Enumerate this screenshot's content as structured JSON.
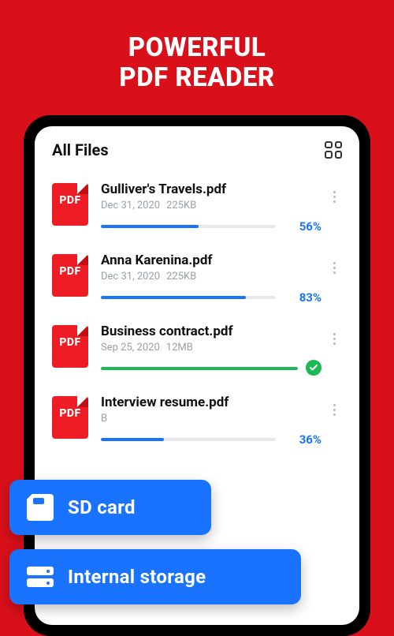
{
  "hero": {
    "line1": "POWERFUL",
    "line2": "PDF READER"
  },
  "screen": {
    "title": "All Files",
    "pdf_badge": "PDF"
  },
  "files": [
    {
      "name": "Gulliver's Travels.pdf",
      "date": "Dec 31, 2020",
      "size": "225KB",
      "progress": 56,
      "percent_label": "56%",
      "bar_color": "#1a73ff",
      "percent_color": "#1a73ff",
      "has_percent": true,
      "has_check": false
    },
    {
      "name": "Anna Karenina.pdf",
      "date": "Dec 31, 2020",
      "size": "225KB",
      "progress": 83,
      "percent_label": "83%",
      "bar_color": "#1a73ff",
      "percent_color": "#1a73ff",
      "has_percent": true,
      "has_check": false
    },
    {
      "name": "Business contract.pdf",
      "date": "Sep 25, 2020",
      "size": "12MB",
      "progress": 100,
      "percent_label": "",
      "bar_color": "#1db954",
      "percent_color": "#1db954",
      "has_percent": false,
      "has_check": true
    },
    {
      "name": "Interview resume.pdf",
      "date": "",
      "size": "B",
      "progress": 36,
      "percent_label": "36%",
      "bar_color": "#1a73ff",
      "percent_color": "#1a73ff",
      "has_percent": true,
      "has_check": false
    }
  ],
  "storage": {
    "sd": "SD card",
    "internal": "Internal storage"
  }
}
